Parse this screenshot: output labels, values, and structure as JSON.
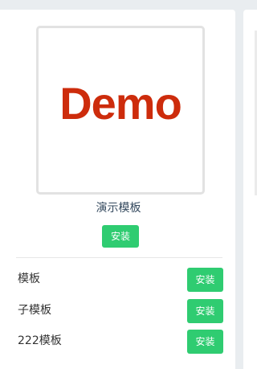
{
  "template_card": {
    "logo_text": "Demo",
    "name": "演示模板",
    "install_label": "安装"
  },
  "template_list": [
    {
      "name": "模板",
      "install_label": "安装"
    },
    {
      "name": "子模板",
      "install_label": "安装"
    },
    {
      "name": "222模板",
      "install_label": "安装"
    }
  ],
  "colors": {
    "logo": "#cd2c0c",
    "install_button": "#2fcc71",
    "template_name": "#34495e"
  }
}
